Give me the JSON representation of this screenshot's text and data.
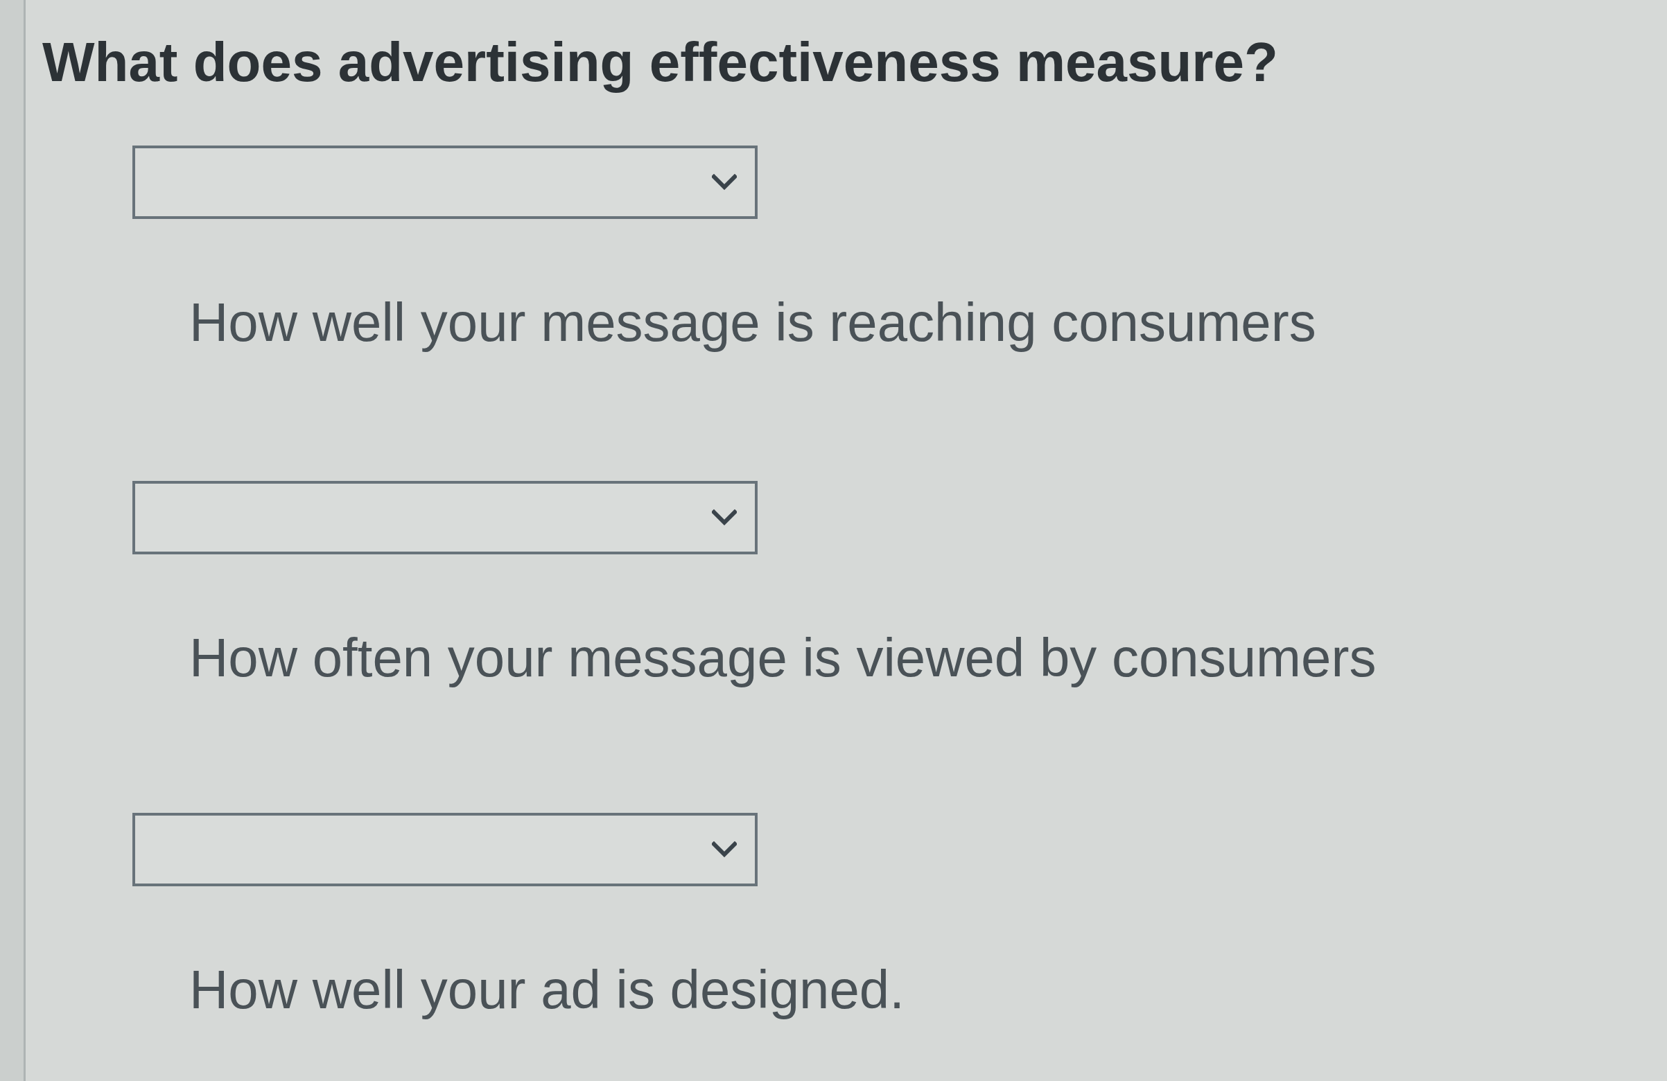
{
  "question": {
    "title": "What does advertising effectiveness measure?"
  },
  "answers": [
    {
      "statement": "How well your message is reaching consumers"
    },
    {
      "statement": "How often your message is viewed by consumers"
    },
    {
      "statement": "How well your ad is designed."
    }
  ]
}
